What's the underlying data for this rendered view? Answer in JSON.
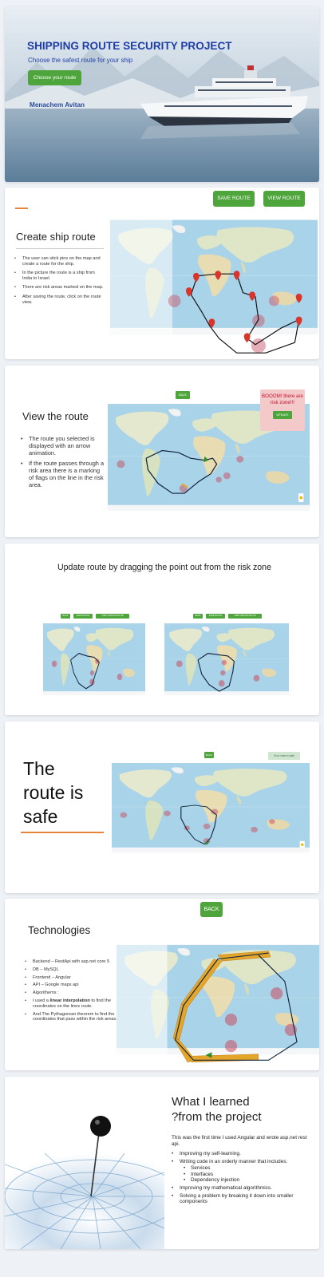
{
  "slide1": {
    "title": "SHIPPING ROUTE SECURITY PROJECT",
    "subtitle": "Choose the safest route for your ship",
    "button": "Choose your route",
    "author": "Menachem Avitan"
  },
  "slide2": {
    "title": "Create ship route",
    "save_button": "SAVE ROUTE",
    "view_button": "VIEW ROUTE",
    "bullets": [
      "The user can stick pins on the map and create a route for the ship.",
      "In the picture the route is a ship from India to Israel.",
      "There are risk areas marked on the map.",
      "After saving the route, click on the route view."
    ]
  },
  "slide3": {
    "title": "View the route",
    "back_button": "BACK",
    "alert_text": "BOOOM! there are risk zone!!!",
    "update_button": "UPDATE",
    "bullets": [
      "The route you selected is displayed with an arrow animation.",
      "If the route passes through a risk area there is a marking of flags on the line in the risk area."
    ]
  },
  "slide4": {
    "title": "Update route by dragging the point out from the risk zone",
    "left_buttons": [
      "BACK",
      "SAVE ROUTE",
      "VIEW UPDATE ROUTE"
    ],
    "right_buttons": [
      "BACK",
      "SAVE ROUTE",
      "VIEW UPDATE ROUTE"
    ]
  },
  "slide5": {
    "title_lines": [
      "The",
      "route is",
      "safe"
    ],
    "back_button": "BACK",
    "safe_badge": "Your route is safe"
  },
  "slide6": {
    "title": "Technologies",
    "back_button": "BACK",
    "bullets": [
      {
        "pre": "Backend – RestApi with asp.net core 5",
        "bold": "",
        "post": ""
      },
      {
        "pre": "DB – MySQL",
        "bold": "",
        "post": ""
      },
      {
        "pre": "Frontend – Angular",
        "bold": "",
        "post": ""
      },
      {
        "pre": "API – Google maps api",
        "bold": "",
        "post": ""
      },
      {
        "pre": "Algorithems :",
        "bold": "",
        "post": ""
      },
      {
        "pre": "I used a ",
        "bold": "linear interpolation",
        "post": " to find the coordinates on the lines route."
      },
      {
        "pre": "And The Pythagorean theorem to find the coordinates that pass within the risk areas.",
        "bold": "",
        "post": ""
      }
    ]
  },
  "slide7": {
    "title_line1": "What I learned",
    "title_line2": "?from the project",
    "intro": "This was the first time I used Angular and wrote asp.net rest api.",
    "bullets": [
      "Improving my self-learning.",
      "Writing code in an orderly manner that includes:",
      "Improving my mathematical algorithmics.",
      "Solving a problem by breaking it down into smaller components"
    ],
    "sub_bullets": [
      "Services",
      "Interfaces",
      "Dependency injection"
    ]
  },
  "colors": {
    "accent_green": "#4ea53b",
    "title_blue": "#1f3fa6",
    "orange_underline": "#e8833a",
    "risk_red": "#c94d63",
    "alert_bg": "#f3c9c9",
    "alert_text": "#c8102e"
  },
  "icons": [
    "map-pin-icon",
    "flag-icon",
    "route-arrow-icon",
    "zoom-control-icon"
  ]
}
